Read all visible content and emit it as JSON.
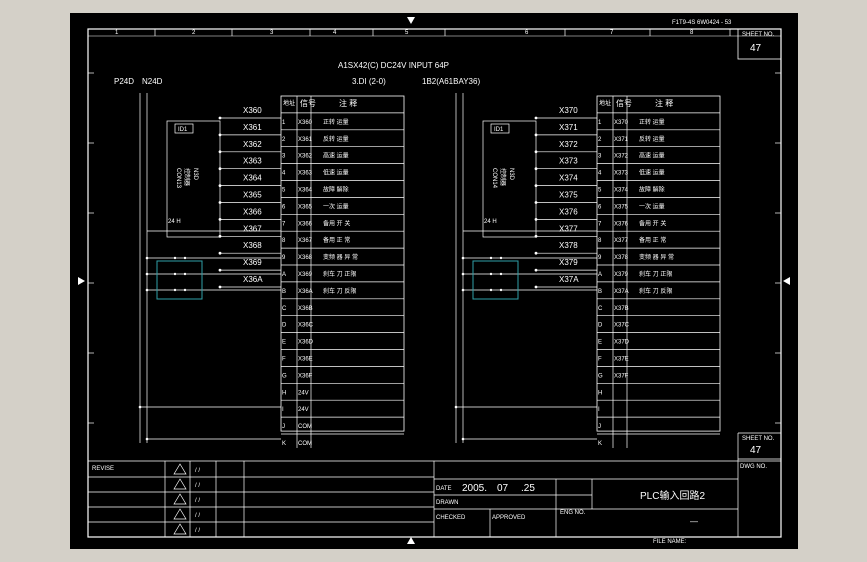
{
  "sheet": {
    "page_number": "47",
    "page_label": "SHEET NO.",
    "drawing_no_label": "DWG NO.",
    "top_right_code": "F1T9-4S   6W0424  - 53",
    "col_numbers": [
      "1",
      "2",
      "3",
      "4",
      "5",
      "6",
      "7",
      "8"
    ]
  },
  "header": {
    "module_line": "A1SX42(C)   DC24V  INPUT  64P",
    "addr_left": "3.DI   (2-0)",
    "addr_right": "1B2(A61BAY36)",
    "p24": "P24D",
    "n24": "N24D"
  },
  "panels": [
    {
      "id": "left",
      "cn_label": "CON13",
      "sub_label": "控制器",
      "rotated_label": "N3D",
      "box_label": "ID1",
      "addresses": [
        "X360",
        "X361",
        "X362",
        "X363",
        "X364",
        "X365",
        "X366",
        "X367",
        "X368",
        "X369",
        "X36A"
      ],
      "table_header": [
        "地址",
        "信号",
        "注 释"
      ],
      "rows": [
        {
          "pin": "1",
          "addr": "X360",
          "note": "正转 运量"
        },
        {
          "pin": "2",
          "addr": "X361",
          "note": "反转 运量"
        },
        {
          "pin": "3",
          "addr": "X362",
          "note": "高速 运量"
        },
        {
          "pin": "4",
          "addr": "X363",
          "note": "低速 运量"
        },
        {
          "pin": "5",
          "addr": "X364",
          "note": "故障 解除"
        },
        {
          "pin": "6",
          "addr": "X365",
          "note": "一次 运量"
        },
        {
          "pin": "7",
          "addr": "X366",
          "note": "备用 开 关"
        },
        {
          "pin": "8",
          "addr": "X367",
          "note": "备用 正 常"
        },
        {
          "pin": "9",
          "addr": "X368",
          "note": "变频 器 异 常"
        },
        {
          "pin": "A",
          "addr": "X369",
          "note": "刹车 刀 正限"
        },
        {
          "pin": "B",
          "addr": "X36A",
          "note": "刹车 刀 反限"
        },
        {
          "pin": "C",
          "addr": "X36B",
          "note": ""
        },
        {
          "pin": "D",
          "addr": "X36C",
          "note": ""
        },
        {
          "pin": "E",
          "addr": "X36D",
          "note": ""
        },
        {
          "pin": "F",
          "addr": "X36E",
          "note": ""
        },
        {
          "pin": "G",
          "addr": "X36F",
          "note": ""
        },
        {
          "pin": "H",
          "addr": "24V",
          "note": ""
        },
        {
          "pin": "I",
          "addr": "24V",
          "note": ""
        },
        {
          "pin": "J",
          "addr": "COM",
          "note": ""
        },
        {
          "pin": "K",
          "addr": "COM",
          "note": ""
        }
      ]
    },
    {
      "id": "right",
      "cn_label": "CON14",
      "sub_label": "控制器",
      "rotated_label": "N3D",
      "box_label": "ID1",
      "addresses": [
        "X370",
        "X371",
        "X372",
        "X373",
        "X374",
        "X375",
        "X376",
        "X377",
        "X378",
        "X379",
        "X37A"
      ],
      "table_header": [
        "地址",
        "信号",
        "注 释"
      ],
      "rows": [
        {
          "pin": "1",
          "addr": "X370",
          "note": "正转 运量"
        },
        {
          "pin": "2",
          "addr": "X371",
          "note": "反转 运量"
        },
        {
          "pin": "3",
          "addr": "X372",
          "note": "高速 运量"
        },
        {
          "pin": "4",
          "addr": "X373",
          "note": "低速 运量"
        },
        {
          "pin": "5",
          "addr": "X374",
          "note": "故障 解除"
        },
        {
          "pin": "6",
          "addr": "X375",
          "note": "一次 运量"
        },
        {
          "pin": "7",
          "addr": "X376",
          "note": "备用 开 关"
        },
        {
          "pin": "8",
          "addr": "X377",
          "note": "备用 正 常"
        },
        {
          "pin": "9",
          "addr": "X378",
          "note": "变频 器 异 常"
        },
        {
          "pin": "A",
          "addr": "X379",
          "note": "刹车 刀 正限"
        },
        {
          "pin": "B",
          "addr": "X37A",
          "note": "刹车 刀 反限"
        },
        {
          "pin": "C",
          "addr": "X37B",
          "note": ""
        },
        {
          "pin": "D",
          "addr": "X37C",
          "note": ""
        },
        {
          "pin": "E",
          "addr": "X37D",
          "note": ""
        },
        {
          "pin": "F",
          "addr": "X37E",
          "note": ""
        },
        {
          "pin": "G",
          "addr": "X37F",
          "note": ""
        },
        {
          "pin": "H",
          "addr": "",
          "note": ""
        },
        {
          "pin": "I",
          "addr": "",
          "note": ""
        },
        {
          "pin": "J",
          "addr": "",
          "note": ""
        },
        {
          "pin": "K",
          "addr": "",
          "note": ""
        }
      ]
    }
  ],
  "title_block": {
    "revision_label": "REVISE",
    "date_label": "DATE",
    "date_year": "2005.",
    "date_month": "07",
    "date_day": ".25",
    "title": "PLC输入回路2",
    "drawn_label": "DRAWN",
    "check_label": "CHECKED",
    "approved_label": "APPROVED",
    "eng_label": "ENG NO.",
    "bottom_code": "FILE NAME:",
    "page_right": "47",
    "dash": "—"
  }
}
